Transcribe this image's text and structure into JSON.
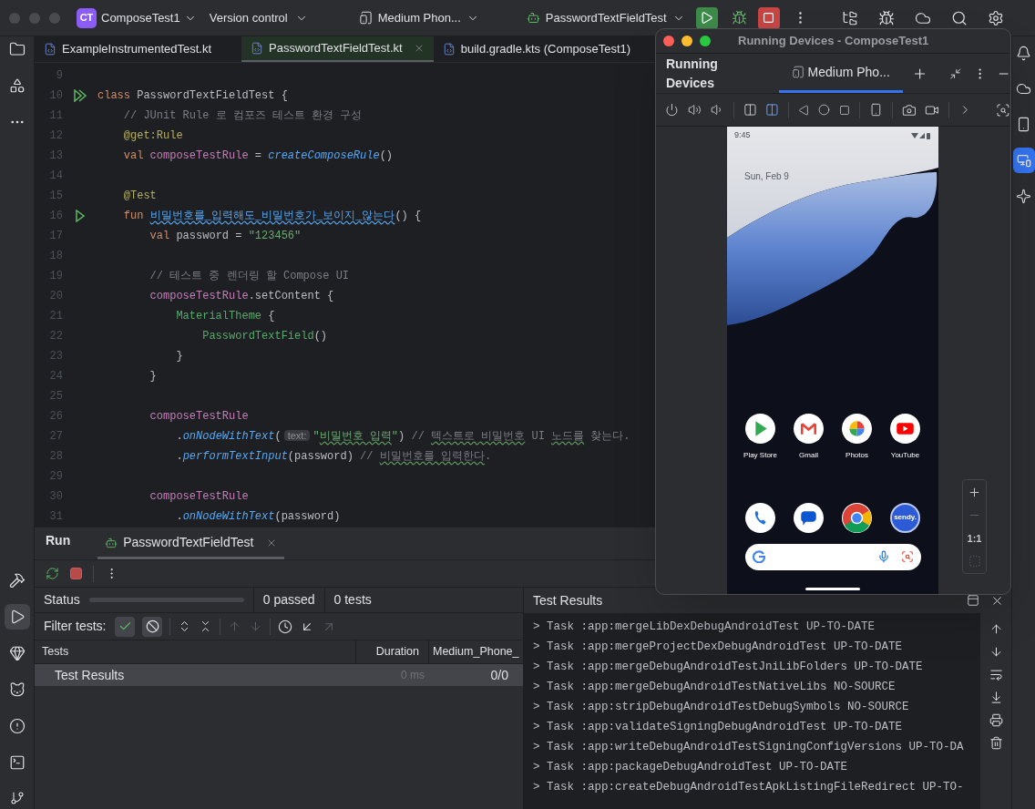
{
  "toolbar": {
    "project_badge": "CT",
    "project": "ComposeTest1",
    "vcs": "Version control",
    "device": "Medium Phon...",
    "run_config": "PasswordTextFieldTest"
  },
  "editor_tabs": [
    {
      "label": "ExampleInstrumentedTest.kt",
      "selected": false
    },
    {
      "label": "PasswordTextFieldTest.kt",
      "selected": true
    },
    {
      "label": "build.gradle.kts (ComposeTest1)",
      "selected": false
    }
  ],
  "code": [
    {
      "n": "9"
    },
    {
      "n": "10",
      "gutter": {
        "kind": "run-all"
      },
      "tokens": [
        {
          "kind": "kw",
          "t": "class "
        },
        {
          "kind": "plain",
          "t": "PasswordTextFieldTest {"
        }
      ]
    },
    {
      "n": "11",
      "tokens": [
        {
          "kind": "comment",
          "t": "    // JUnit Rule 로 컴포즈 테스트 환경 구성"
        }
      ]
    },
    {
      "n": "12",
      "tokens": [
        {
          "kind": "ann",
          "t": "    @get:Rule"
        }
      ]
    },
    {
      "n": "13",
      "tokens": [
        {
          "kind": "kw",
          "t": "    val "
        },
        {
          "kind": "prop",
          "t": "composeTestRule"
        },
        {
          "kind": "plain",
          "t": " = "
        },
        {
          "kind": "call",
          "t": "createComposeRule"
        },
        {
          "kind": "plain",
          "t": "()"
        }
      ]
    },
    {
      "n": "14"
    },
    {
      "n": "15",
      "tokens": [
        {
          "kind": "ann",
          "t": "    @Test"
        }
      ]
    },
    {
      "n": "16",
      "gutter": {
        "kind": "run-one"
      },
      "tokens": [
        {
          "kind": "kw",
          "t": "    fun "
        },
        {
          "kind": "def",
          "t": "비밀번호를_입력해도_비밀번호가_보이지_않는다"
        },
        {
          "kind": "plain",
          "t": "() {"
        }
      ]
    },
    {
      "n": "17",
      "tokens": [
        {
          "kind": "kw",
          "t": "        val "
        },
        {
          "kind": "plain",
          "t": "password = "
        },
        {
          "kind": "str",
          "t": "\"123456\""
        }
      ]
    },
    {
      "n": "18"
    },
    {
      "n": "19",
      "tokens": [
        {
          "kind": "comment",
          "t": "        // 테스트 중 렌더링 할 Compose UI"
        }
      ]
    },
    {
      "n": "20",
      "tokens": [
        {
          "kind": "prop",
          "t": "        composeTestRule"
        },
        {
          "kind": "plain",
          "t": ".setContent {"
        }
      ]
    },
    {
      "n": "21",
      "tokens": [
        {
          "kind": "compose",
          "t": "            MaterialTheme"
        },
        {
          "kind": "plain",
          "t": " {"
        }
      ]
    },
    {
      "n": "22",
      "tokens": [
        {
          "kind": "compose",
          "t": "                PasswordTextField"
        },
        {
          "kind": "plain",
          "t": "()"
        }
      ]
    },
    {
      "n": "23",
      "tokens": [
        {
          "kind": "plain",
          "t": "            }"
        }
      ]
    },
    {
      "n": "24",
      "tokens": [
        {
          "kind": "plain",
          "t": "        }"
        }
      ]
    },
    {
      "n": "25"
    },
    {
      "n": "26",
      "tokens": [
        {
          "kind": "prop",
          "t": "        composeTestRule"
        }
      ]
    },
    {
      "n": "27",
      "tokens": [
        {
          "kind": "plain",
          "t": "            ."
        },
        {
          "kind": "call",
          "t": "onNodeWithText"
        },
        {
          "kind": "plain",
          "t": "("
        },
        {
          "kind": "hint",
          "t": "text:"
        },
        {
          "kind": "str",
          "t": "\""
        },
        {
          "kind": "str-typo",
          "t": "비밀번호 입력"
        },
        {
          "kind": "str",
          "t": "\""
        },
        {
          "kind": "plain",
          "t": ")"
        },
        {
          "kind": "comment",
          "t": " // "
        },
        {
          "kind": "comment-typo",
          "t": "텍스트로 비밀번호"
        },
        {
          "kind": "comment",
          "t": " UI "
        },
        {
          "kind": "comment-typo",
          "t": "노드를"
        },
        {
          "kind": "comment",
          "t": " 찾는다."
        }
      ]
    },
    {
      "n": "28",
      "tokens": [
        {
          "kind": "plain",
          "t": "            ."
        },
        {
          "kind": "call",
          "t": "performTextInput"
        },
        {
          "kind": "plain",
          "t": "(password) "
        },
        {
          "kind": "comment",
          "t": "// "
        },
        {
          "kind": "comment-typo",
          "t": "비밀번호를 입력한다"
        },
        {
          "kind": "comment",
          "t": "."
        }
      ]
    },
    {
      "n": "29"
    },
    {
      "n": "30",
      "tokens": [
        {
          "kind": "prop",
          "t": "        composeTestRule"
        }
      ]
    },
    {
      "n": "31",
      "tokens": [
        {
          "kind": "plain",
          "t": "            ."
        },
        {
          "kind": "call",
          "t": "onNodeWithText"
        },
        {
          "kind": "plain",
          "t": "(password)"
        }
      ]
    }
  ],
  "running_devices": {
    "title": "Running Devices - ComposeTest1",
    "heading": "Running Devices",
    "device_tab": "Medium Pho...",
    "zoom_label": "1:1",
    "phone": {
      "time": "9:45",
      "date": "Sun, Feb 9",
      "apps": [
        {
          "kind": "store",
          "label": "Play Store"
        },
        {
          "kind": "mail",
          "label": "Gmail"
        },
        {
          "kind": "photos",
          "label": "Photos"
        },
        {
          "kind": "video",
          "label": "YouTube"
        }
      ],
      "dock": [
        {
          "kind": "phone"
        },
        {
          "kind": "chat"
        },
        {
          "kind": "browser"
        },
        {
          "kind": "text",
          "text": "sendy."
        }
      ]
    }
  },
  "run_panel": {
    "title": "Run",
    "tab": {
      "label": "PasswordTextFieldTest",
      "selected": true
    },
    "status": {
      "label": "Status",
      "level": 0,
      "passed": "0 passed",
      "tests": "0 tests"
    },
    "filter": {
      "label": "Filter tests:",
      "toggles": [
        {
          "kind": "passed",
          "selected": true
        },
        {
          "kind": "ignored",
          "selected": true
        }
      ]
    },
    "columns": [
      "Tests",
      "Duration",
      "Medium_Phone_"
    ],
    "rows": [
      {
        "name": "Test Results",
        "duration": "0 ms",
        "result": "0/0",
        "selected": true
      }
    ],
    "console": {
      "title": "Test Results",
      "lines": [
        "> Task :app:mergeLibDexDebugAndroidTest UP-TO-DATE",
        "> Task :app:mergeProjectDexDebugAndroidTest UP-TO-DATE",
        "> Task :app:mergeDebugAndroidTestJniLibFolders UP-TO-DATE",
        "> Task :app:mergeDebugAndroidTestNativeLibs NO-SOURCE",
        "> Task :app:stripDebugAndroidTestDebugSymbols NO-SOURCE",
        "> Task :app:validateSigningDebugAndroidTest UP-TO-DATE",
        "> Task :app:writeDebugAndroidTestSigningConfigVersions UP-TO-DA",
        "> Task :app:packageDebugAndroidTest UP-TO-DATE",
        "> Task :app:createDebugAndroidTestApkListingFileRedirect UP-TO-"
      ]
    }
  }
}
